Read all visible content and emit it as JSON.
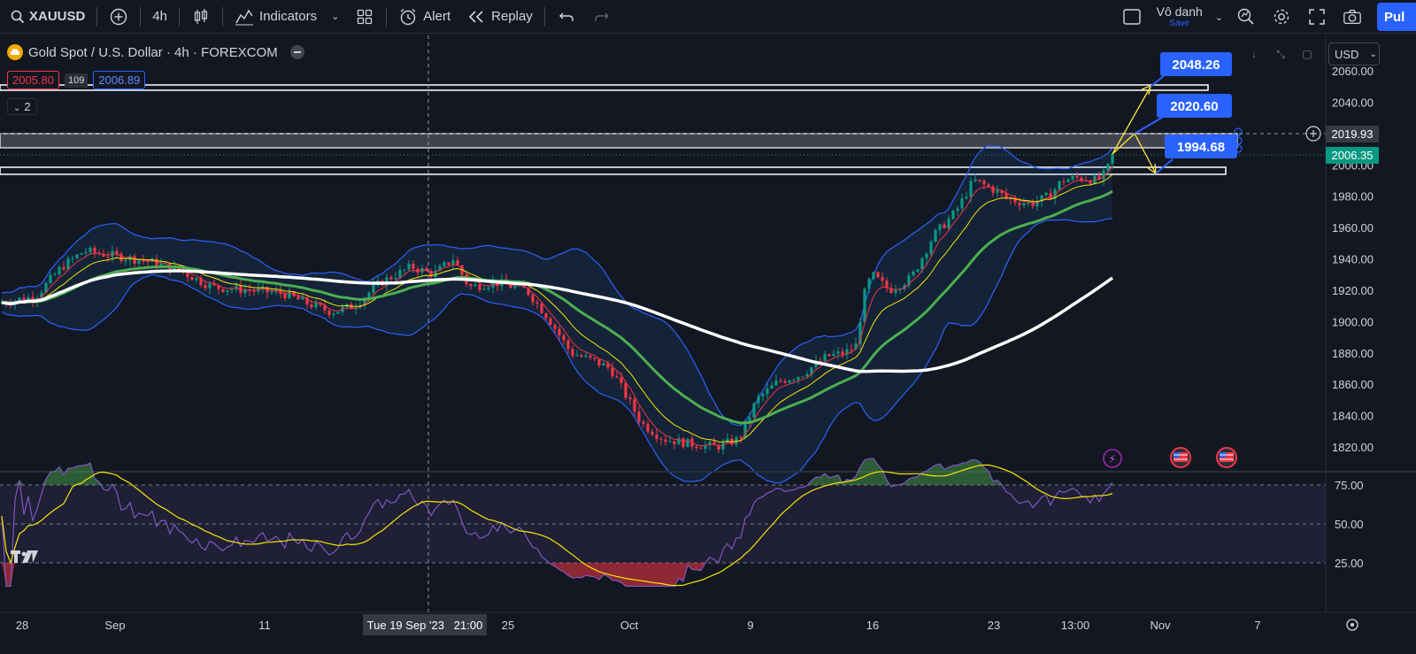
{
  "toolbar": {
    "symbol": "XAUUSD",
    "interval": "4h",
    "indicators_label": "Indicators",
    "alert_label": "Alert",
    "replay_label": "Replay",
    "layout_name": "Vô danh",
    "layout_save": "Save",
    "publish_label": "Pul"
  },
  "legend": {
    "title": "Gold Spot / U.S. Dollar · 4h · FOREXCOM",
    "sell_price": "2005.80",
    "spread": "109",
    "buy_price": "2006.89",
    "indicator_count": "2"
  },
  "currency": "USD",
  "price_axis": {
    "ticks": [
      "2060.00",
      "2040.00",
      "2020.00",
      "2000.00",
      "1980.00",
      "1960.00",
      "1940.00",
      "1920.00",
      "1900.00",
      "1880.00",
      "1860.00",
      "1840.00",
      "1820.00"
    ],
    "crosshair_label": "2019.93",
    "last_price_label": "2006.35"
  },
  "rsi_axis": {
    "ticks": [
      "75.00",
      "50.00",
      "25.00"
    ]
  },
  "time_axis": {
    "ticks": [
      "28",
      "Sep",
      "11",
      "25",
      "Oct",
      "9",
      "16",
      "23",
      "13:00",
      "Nov",
      "7"
    ],
    "crosshair_label": "Tue 19 Sep '23   21:00"
  },
  "annotations": {
    "target_high": "2048.26",
    "target_mid": "2020.60",
    "target_low": "1994.68"
  },
  "colors": {
    "background": "#131722",
    "up_candle": "#089981",
    "down_candle": "#f23645",
    "bollinger": "#2962ff",
    "ema_fast": "#f23645",
    "ema_mid": "#f7e600",
    "ema_slow": "#4caf50",
    "sma_long": "#ffffff",
    "rsi": "#7e57c2",
    "rsi_signal": "#f7e600",
    "projection": "#ffeb3b",
    "label_bg": "#2962ff"
  },
  "icons": [
    "search-icon",
    "plus-circle-icon",
    "candles-icon",
    "indicators-icon",
    "templates-icon",
    "alarm-clock-icon",
    "replay-icon",
    "undo-icon",
    "redo-icon",
    "layout-icon",
    "alert-icon",
    "settings-icon",
    "fullscreen-icon",
    "camera-icon",
    "tradingview-logo"
  ]
}
